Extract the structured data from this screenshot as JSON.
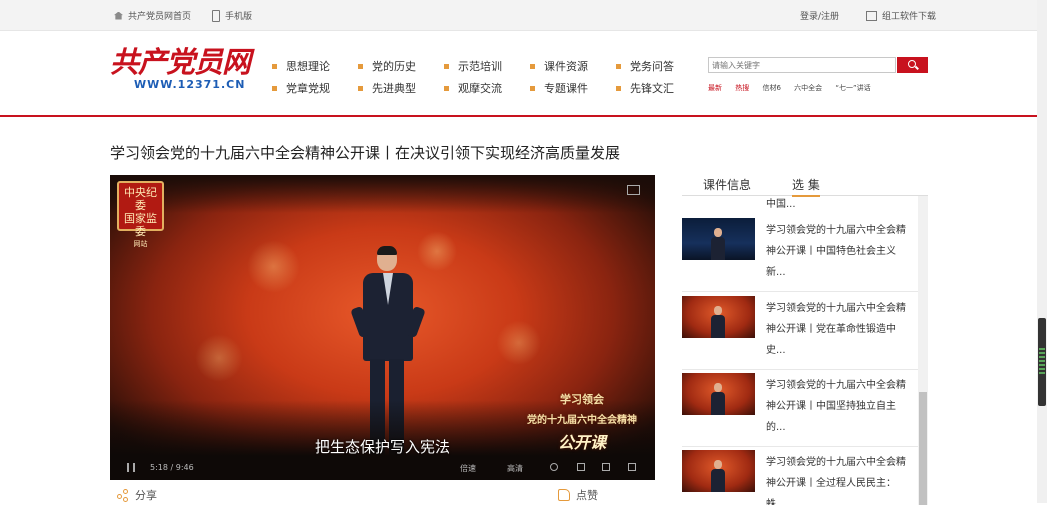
{
  "topbar": {
    "home": "共产党员网首页",
    "mobile": "手机版",
    "login": "登录/注册",
    "download": "组工软件下载"
  },
  "logo": {
    "name": "共产党员网",
    "url": "WWW.12371.CN"
  },
  "nav": [
    "思想理论",
    "党的历史",
    "示范培训",
    "课件资源",
    "党务问答",
    "党章党规",
    "先进典型",
    "观摩交流",
    "专题课件",
    "先锋文汇"
  ],
  "search": {
    "placeholder": "请输入关键字",
    "hot": [
      "最新",
      "热搜",
      "信材6",
      "六中全会",
      "“七一”讲话"
    ]
  },
  "page_title": "学习领会党的十九届六中全会精神公开课丨在决议引领下实现经济高质量发展",
  "video": {
    "seal_line1": "中央纪委",
    "seal_line2": "国家监委",
    "seal_line3": "网站",
    "overlay_line1": "学习领会",
    "overlay_line2": "党的十九届六中全会精神",
    "overlay_line3": "公开课",
    "subtitle": "把生态保护写入宪法",
    "time": "5:18 / 9:46",
    "quality1": "倍速",
    "quality2": "高清"
  },
  "actions": {
    "share": "分享",
    "like": "点赞"
  },
  "panel": {
    "tabs": [
      "课件信息",
      "选 集"
    ],
    "active_tab": 1,
    "fragment": "中国...",
    "items": [
      {
        "title": "学习领会党的十九届六中全会精神公开课丨中国特色社会主义新..."
      },
      {
        "title": "学习领会党的十九届六中全会精神公开课丨党在革命性锻造中史..."
      },
      {
        "title": "学习领会党的十九届六中全会精神公开课丨中国坚持独立自主的..."
      },
      {
        "title": "学习领会党的十九届六中全会精神公开课丨全过程人民民主：蛛..."
      }
    ]
  },
  "colors": {
    "brand_red": "#c8121e",
    "accent_orange": "#e59a3c",
    "url_blue": "#1d5db5"
  }
}
